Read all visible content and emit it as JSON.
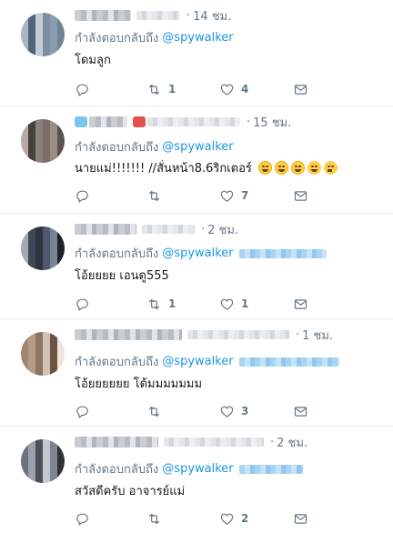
{
  "tweets": [
    {
      "time": "14 ชม.",
      "reply_label": "กำลังตอบกลับถึง",
      "reply_to": "@spywalker",
      "text": "โดมลูก",
      "replies": "",
      "retweets": "1",
      "likes": "4"
    },
    {
      "time": "15 ชม.",
      "reply_label": "กำลังตอบกลับถึง",
      "reply_to": "@spywalker",
      "text": "นายแม่!!!!!!! //สั่นหน้า8.6ริกเตอร์",
      "emoji": [
        "face-with-tears-of-joy",
        "face-with-tears-of-joy",
        "face-with-tears-of-joy",
        "grinning-face-with-sweat",
        "thinking-face"
      ],
      "replies": "",
      "retweets": "",
      "likes": "7"
    },
    {
      "time": "2 ชม.",
      "reply_label": "กำลังตอบกลับถึง",
      "reply_to": "@spywalker",
      "text": "โอ้ยยยย เอนดู555",
      "replies": "",
      "retweets": "1",
      "likes": "1"
    },
    {
      "time": "1 ชม.",
      "reply_label": "กำลังตอบกลับถึง",
      "reply_to": "@spywalker",
      "text": "โอ้ยยยยยย โด้มมมมมมม",
      "replies": "",
      "retweets": "",
      "likes": "3"
    },
    {
      "time": "2 ชม.",
      "reply_label": "กำลังตอบกลับถึง",
      "reply_to": "@spywalker",
      "text": "สวัสดีครับ อาจารย์แม่",
      "replies": "",
      "retweets": "",
      "likes": "2"
    }
  ],
  "colors": {
    "link": "#1b95e0",
    "muted": "#657786",
    "text": "#14171a",
    "divider": "#e6ecf0"
  },
  "icons": {
    "reply": "reply-icon",
    "retweet": "retweet-icon",
    "like": "heart-icon",
    "dm": "envelope-icon"
  }
}
